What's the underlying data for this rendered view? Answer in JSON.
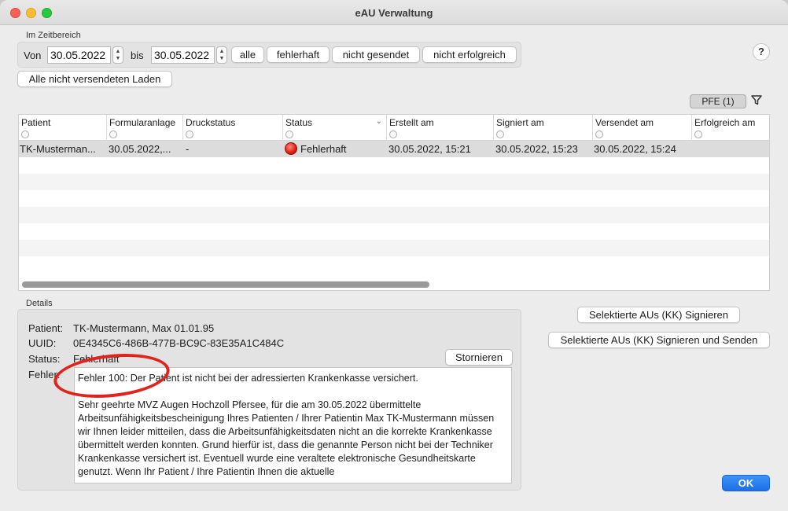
{
  "window": {
    "title": "eAU Verwaltung"
  },
  "filters": {
    "group_label": "Im Zeitbereich",
    "from_label": "Von",
    "from_value": "30.05.2022",
    "to_label": "bis",
    "to_value": "30.05.2022",
    "buttons": [
      "alle",
      "fehlerhaft",
      "nicht gesendet",
      "nicht erfolgreich"
    ],
    "load_unsent_label": "Alle nicht versendeten Laden"
  },
  "help_label": "?",
  "pfe_label": "PFE (1)",
  "table": {
    "columns": [
      "Patient",
      "Formularanlage",
      "Druckstatus",
      "Status",
      "Erstellt am",
      "Signiert am",
      "Versendet am",
      "Erfolgreich am"
    ],
    "rows": [
      {
        "patient": "TK-Musterman...",
        "formularanlage": "30.05.2022,...",
        "druckstatus": "-",
        "status": "Fehlerhaft",
        "erstellt": "30.05.2022, 15:21",
        "signiert": "30.05.2022, 15:23",
        "versendet": "30.05.2022, 15:24",
        "erfolgreich": ""
      }
    ]
  },
  "details": {
    "group_label": "Details",
    "patient_label": "Patient:",
    "patient_value": "TK-Mustermann, Max 01.01.95",
    "uuid_label": "UUID:",
    "uuid_value": "0E4345C6-486B-477B-BC9C-83E35A1C484C",
    "status_label": "Status:",
    "status_value": "Fehlerhaft",
    "error_label": "Fehler:",
    "error_line": "Fehler 100: Der Patient ist nicht bei der adressierten Krankenkasse versichert.",
    "error_body": "Sehr geehrte MVZ Augen Hochzoll Pfersee, für die am 30.05.2022 übermittelte Arbeitsunfähigkeitsbescheinigung Ihres Patienten / Ihrer Patientin  Max TK-Mustermann müssen wir Ihnen leider mitteilen, dass die Arbeitsunfähigkeitsdaten nicht an die korrekte Krankenkasse übermittelt werden konnten. Grund hierfür ist, dass die genannte Person nicht bei der Techniker Krankenkasse versichert ist. Eventuell wurde eine veraltete elektronische Gesundheitskarte genutzt. Wenn Ihr Patient / Ihre Patientin Ihnen die aktuelle",
    "cancel_label": "Stornieren"
  },
  "actions": {
    "sign_label": "Selektierte AUs (KK) Signieren",
    "sign_send_label": "Selektierte AUs (KK) Signieren und Senden",
    "ok_label": "OK"
  },
  "colors": {
    "accent": "#1f6fe6",
    "error": "#e2231a"
  }
}
